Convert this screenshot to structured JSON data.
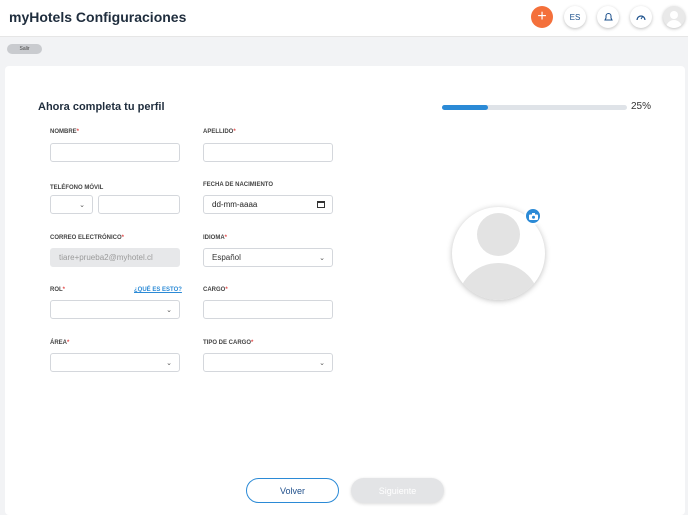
{
  "app": {
    "title": "myHotels Configuraciones"
  },
  "toolbar": {
    "add_label": "+",
    "language": "ES"
  },
  "exit_label": "Salir",
  "form": {
    "heading": "Ahora completa tu perfil",
    "progress": {
      "percent": 25,
      "label": "25%"
    },
    "nombre": {
      "label": "NOMBRE",
      "value": ""
    },
    "apellido": {
      "label": "APELLIDO",
      "value": ""
    },
    "telefono": {
      "label": "TELÉFONO MÓVIL",
      "code": "",
      "number": ""
    },
    "fecha": {
      "label": "FECHA DE NACIMIENTO",
      "value": "dd-mm-aaaa"
    },
    "correo": {
      "label": "CORREO ELECTRÓNICO",
      "value": "tiare+prueba2@myhotel.cl"
    },
    "idioma": {
      "label": "IDIOMA",
      "value": "Español"
    },
    "rol": {
      "label": "ROL",
      "value": "",
      "help": "¿QUÉ ES ESTO?"
    },
    "cargo": {
      "label": "CARGO",
      "value": ""
    },
    "area": {
      "label": "ÁREA",
      "value": ""
    },
    "tipo_cargo": {
      "label": "TIPO DE CARGO",
      "value": ""
    },
    "required_mark": "*"
  },
  "actions": {
    "back": "Volver",
    "next": "Siguiente"
  },
  "colors": {
    "accent": "#2b8ad6",
    "add_button": "#f4703b",
    "required": "#e24a4a"
  },
  "icons": [
    "add-icon",
    "bell-icon",
    "speedometer-icon",
    "user-avatar-icon",
    "camera-icon",
    "chevron-down-icon",
    "calendar-icon"
  ]
}
